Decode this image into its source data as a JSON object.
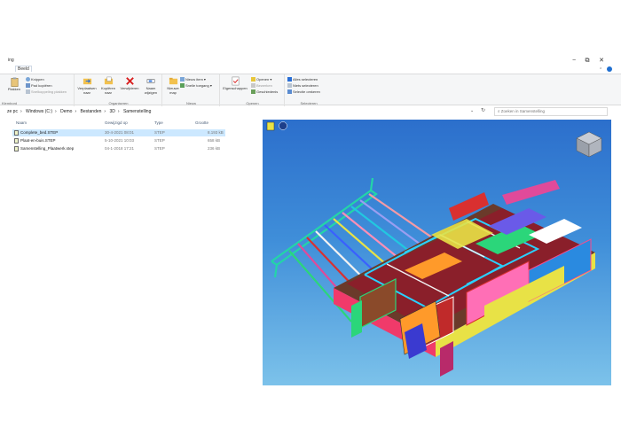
{
  "window": {
    "title": "ing",
    "minimize": "−",
    "maximize": "⧉",
    "close": "✕"
  },
  "ribbon": {
    "active_tab": "Beeld",
    "groups": [
      {
        "label": "Klembord"
      },
      {
        "label": "Organiseren"
      },
      {
        "label": "Nieuw"
      },
      {
        "label": "Openen"
      },
      {
        "label": "Selecteren"
      }
    ],
    "klembord": {
      "paste": "Plakken",
      "cut": "Knippen",
      "copy_path": "Pad kopiëren",
      "paste_shortcut": "Snelkoppeling plakken"
    },
    "organiseren": {
      "move_to": "Verplaatsen naar",
      "copy_to": "Kopiëren naar",
      "delete": "Verwijderen",
      "rename": "Naam wijzigen"
    },
    "nieuw": {
      "new_folder": "Nieuwe map",
      "new_item": "Nieuw item",
      "easy_access": "Snelle toegang"
    },
    "openen": {
      "properties": "Eigenschappen",
      "open": "Openen",
      "edit": "Bewerken",
      "history": "Geschiedenis"
    },
    "selecteren": {
      "select_all": "Alles selecteren",
      "select_none": "Niets selecteren",
      "invert": "Selectie omkeren"
    }
  },
  "address": {
    "crumbs": [
      "ze pc",
      "Windows (C:)",
      "Demo",
      "Bestanden",
      "3D",
      "Samenstelling"
    ],
    "search_placeholder": "Zoeken in Samenstelling"
  },
  "columns": [
    "Naam",
    "Gewijzigd op",
    "Type",
    "Grootte"
  ],
  "files": [
    {
      "name": "Complete_bed.STEP",
      "modified": "30-4-2021 08:01",
      "type": "STEP",
      "size": "8.193 kB",
      "selected": true
    },
    {
      "name": "Plaat-en-buis.STEP",
      "modified": "5-10-2021 10:03",
      "type": "STEP",
      "size": "658 kB",
      "selected": false
    },
    {
      "name": "Samenstelling_Plaatwerk.step",
      "modified": "04-1-2018 17:21",
      "type": "STEP",
      "size": "236 kB",
      "selected": false
    }
  ],
  "colors": {
    "selection": "#cce8ff",
    "preview_top": "#2c6fcc",
    "preview_bottom": "#7cc2ea"
  }
}
